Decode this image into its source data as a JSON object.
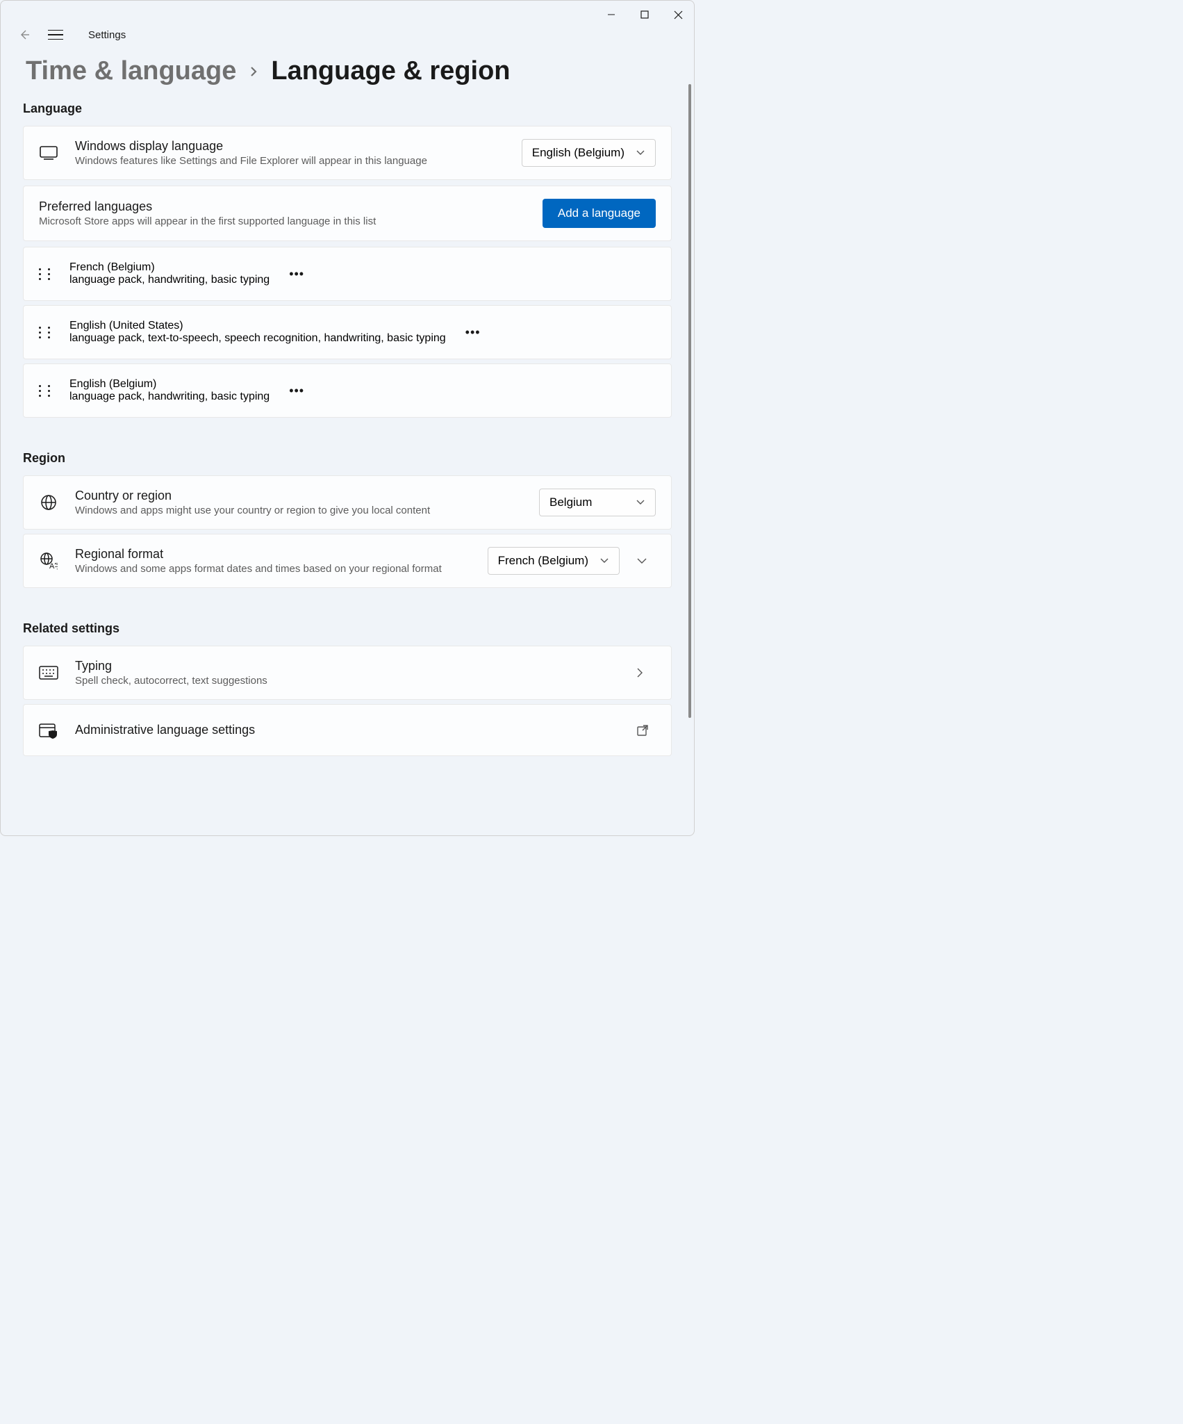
{
  "app": {
    "title": "Settings"
  },
  "breadcrumb": {
    "parent": "Time & language",
    "current": "Language & region"
  },
  "sections": {
    "language": {
      "header": "Language",
      "display_lang": {
        "title": "Windows display language",
        "subtitle": "Windows features like Settings and File Explorer will appear in this language",
        "value": "English (Belgium)"
      },
      "preferred": {
        "title": "Preferred languages",
        "subtitle": "Microsoft Store apps will appear in the first supported language in this list",
        "add_button": "Add a language",
        "items": [
          {
            "name": "French (Belgium)",
            "features": "language pack, handwriting, basic typing"
          },
          {
            "name": "English (United States)",
            "features": "language pack, text-to-speech, speech recognition, handwriting, basic typing"
          },
          {
            "name": "English (Belgium)",
            "features": "language pack, handwriting, basic typing"
          }
        ]
      }
    },
    "region": {
      "header": "Region",
      "country": {
        "title": "Country or region",
        "subtitle": "Windows and apps might use your country or region to give you local content",
        "value": "Belgium"
      },
      "format": {
        "title": "Regional format",
        "subtitle": "Windows and some apps format dates and times based on your regional format",
        "value": "French (Belgium)"
      }
    },
    "related": {
      "header": "Related settings",
      "typing": {
        "title": "Typing",
        "subtitle": "Spell check, autocorrect, text suggestions"
      },
      "admin": {
        "title": "Administrative language settings"
      }
    }
  }
}
